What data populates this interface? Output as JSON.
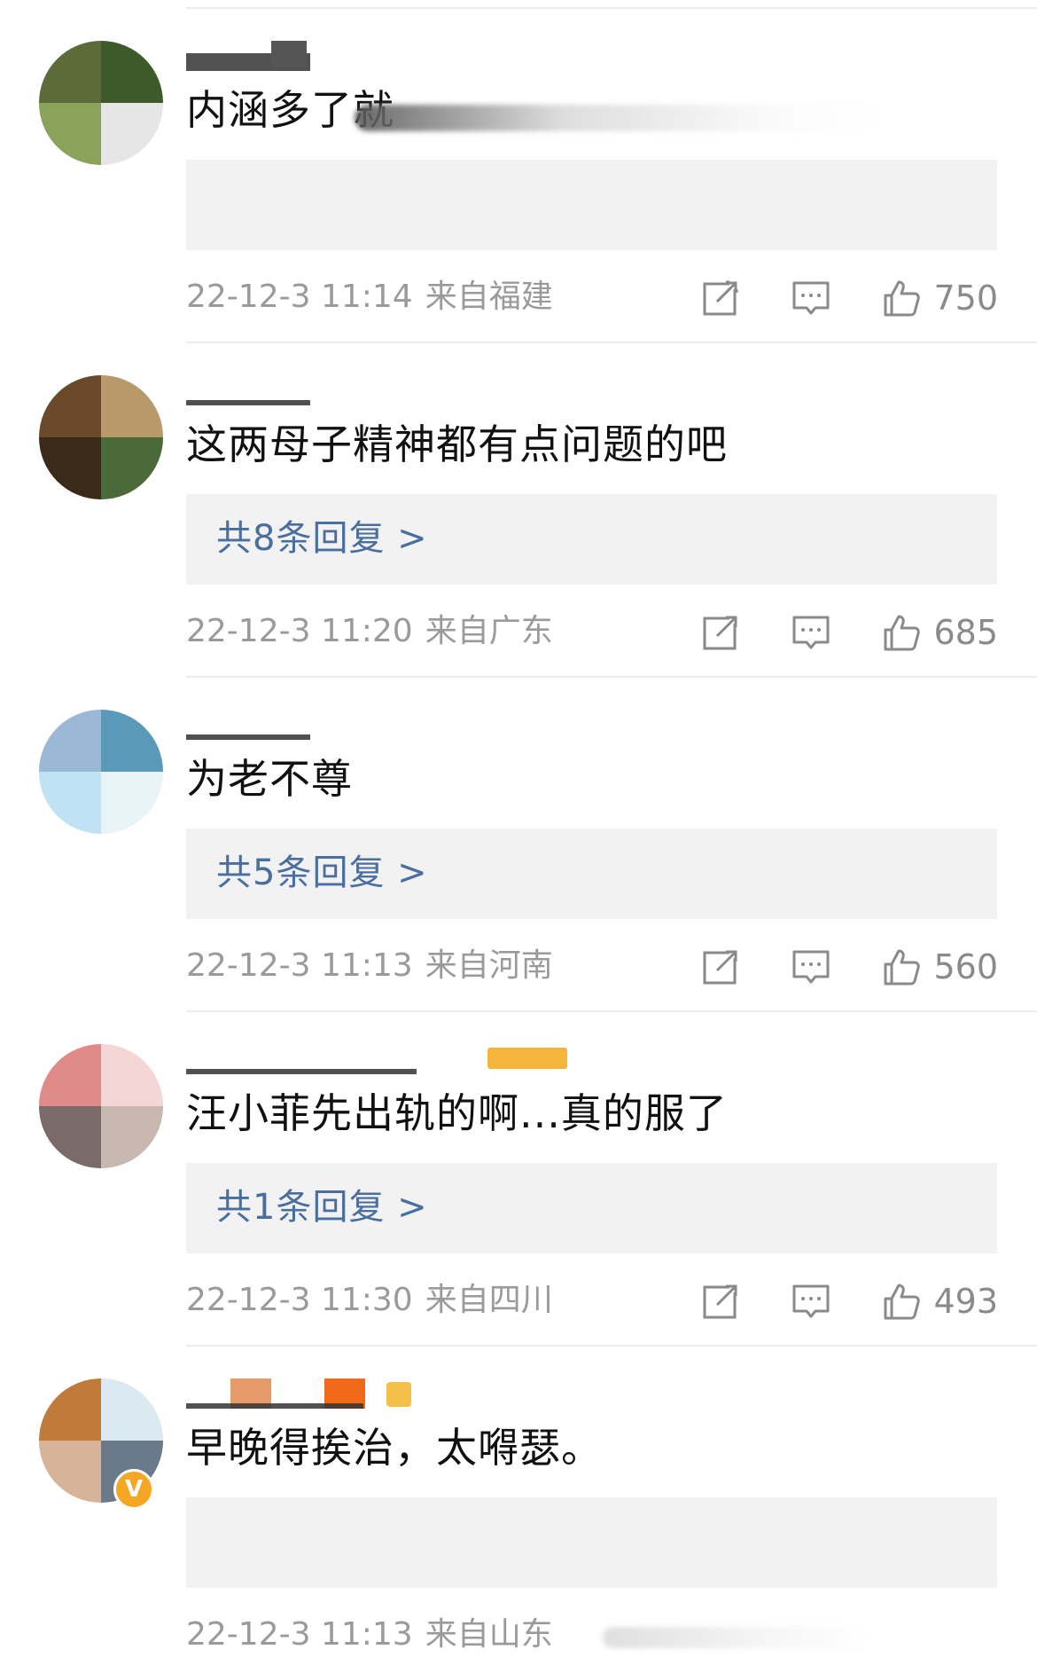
{
  "comments": [
    {
      "text": "内涵多了就",
      "reply_label": "",
      "time": "22-12-3 11:14",
      "location": "来自福建",
      "likes": "750"
    },
    {
      "text": "这两母子精神都有点问题的吧",
      "reply_label": "共8条回复 >",
      "time": "22-12-3 11:20",
      "location": "来自广东",
      "likes": "685"
    },
    {
      "text": "为老不尊",
      "reply_label": "共5条回复 >",
      "time": "22-12-3 11:13",
      "location": "来自河南",
      "likes": "560"
    },
    {
      "text": "汪小菲先出轨的啊...真的服了",
      "reply_label": "共1条回复 >",
      "time": "22-12-3 11:30",
      "location": "来自四川",
      "likes": "493"
    },
    {
      "text": "早晚得挨治，太嘚瑟。",
      "reply_label": "",
      "time": "22-12-3 11:13",
      "location": "来自山东",
      "likes": ""
    }
  ],
  "icons": {
    "share": "share-icon",
    "comment": "comment-icon",
    "like": "like-icon",
    "verified": "verified-badge-icon"
  },
  "colors": {
    "reply_link": "#4a6f9e",
    "meta_text": "#9a9a9a",
    "reply_bg": "#f2f2f2",
    "verified_badge": "#f5a623"
  }
}
